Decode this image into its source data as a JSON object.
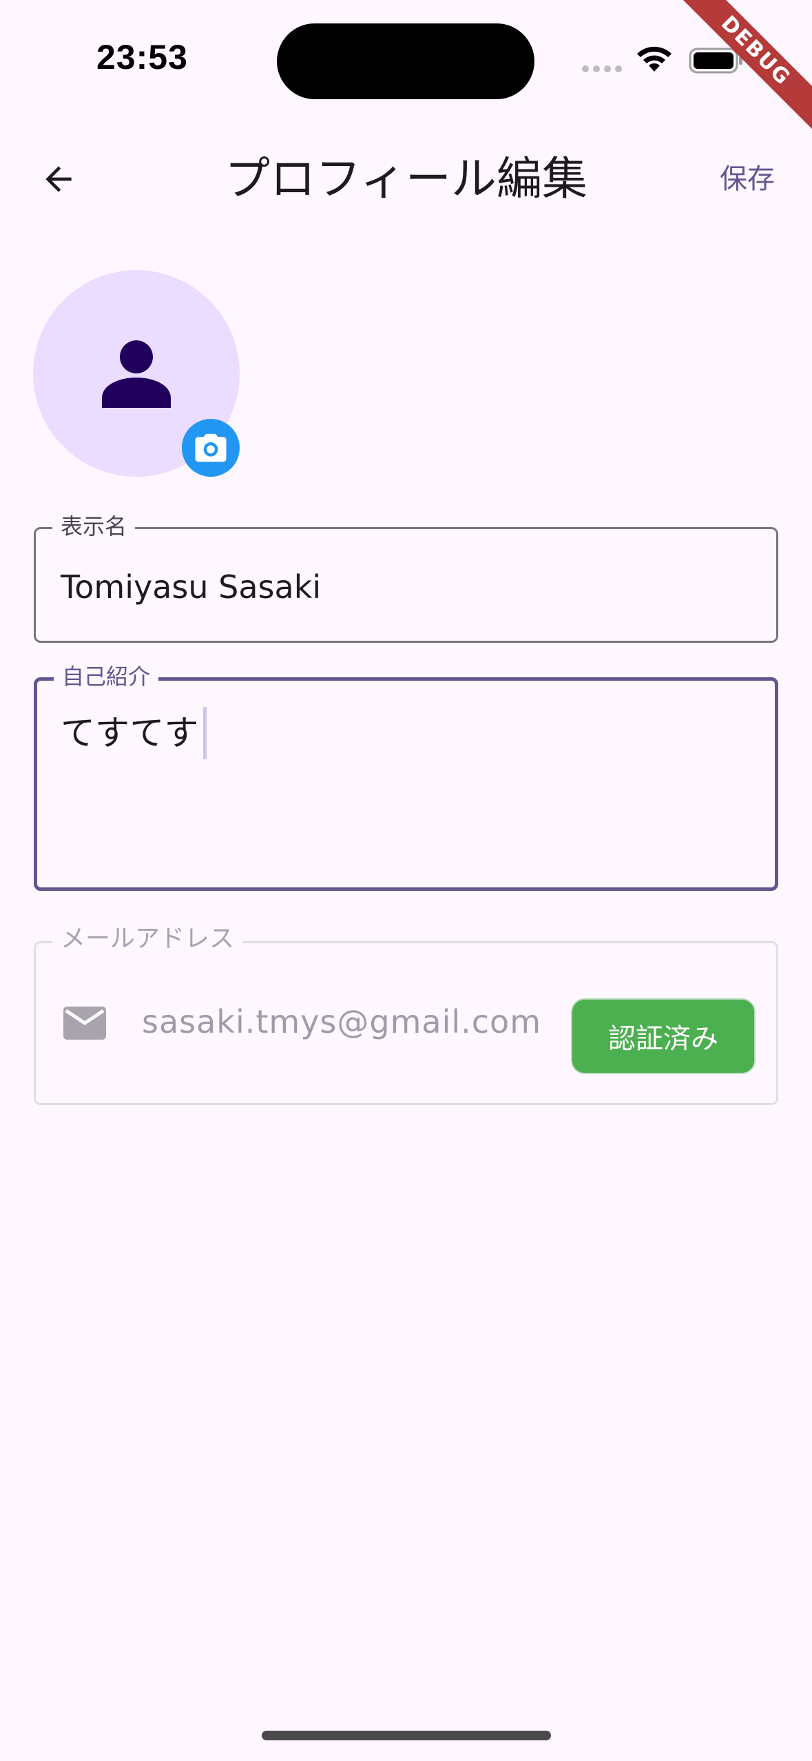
{
  "status_bar": {
    "time": "23:53",
    "debug_label": "DEBUG"
  },
  "app_bar": {
    "title": "プロフィール編集",
    "save_label": "保存",
    "back_icon": "arrow-back-icon"
  },
  "avatar": {
    "icon": "person-icon",
    "badge_icon": "camera-icon"
  },
  "form": {
    "display_name": {
      "label": "表示名",
      "value": "Tomiyasu Sasaki"
    },
    "bio": {
      "label": "自己紹介",
      "value": "てすてす"
    },
    "email": {
      "label": "メールアドレス",
      "value": "sasaki.tmys@gmail.com",
      "icon": "mail-icon",
      "status_label": "認証済み"
    }
  },
  "colors": {
    "background": "#FEF7FF",
    "primary": "#65558F",
    "avatar_bg": "#EADDFF",
    "camera_badge": "#2196F3",
    "verified": "#4CAF50",
    "debug_ribbon": "#B53A3A"
  }
}
